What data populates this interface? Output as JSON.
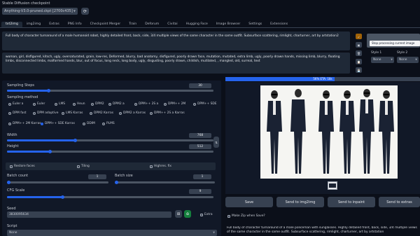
{
  "checkpoint": {
    "label": "Stable Diffusion checkpoint",
    "value": "Anything-V3.0-pruned.ckpt [2700c435]"
  },
  "tabs": [
    "txt2img",
    "img2img",
    "Extras",
    "PNG Info",
    "Checkpoint Merger",
    "Train",
    "Deforum",
    "Civitai",
    "Hugging Face",
    "Image Browser",
    "Settings",
    "Extensions"
  ],
  "active_tab": "txt2img",
  "prompt": "Full body of character turnaround of a male humanoid robot, highly detailed front, back, side, 3/4 multiple views of the same character in the same outfit. Subsurface scattering, rimlight, charturner, art by artstation2",
  "negative_prompt": "woman, girl, disfigured, kitsch, ugly, oversaturated, grain, low-res, Deformed, blurry, bad anatomy, disfigured, poorly drawn face, mutation, mutated, extra limb, ugly, poorly drawn hands, missing limb, blurry, floating limbs, disconnected limbs, malformed hands, blur, out of focus, long neck, long body, ugly, disgusting, poorly drawn, childish, mutilated, , mangled, old, surreal, text",
  "tooltip": "Stop processing current image",
  "styles": [
    {
      "label": "Style 1",
      "value": "None"
    },
    {
      "label": "Style 2",
      "value": "None"
    }
  ],
  "sampling_steps": {
    "label": "Sampling Steps",
    "value": "30",
    "fraction": 0.2
  },
  "sampling_method": {
    "label": "Sampling method",
    "options": [
      "Euler a",
      "Euler",
      "LMS",
      "Heun",
      "DPM2",
      "DPM2 a",
      "DPM++ 2S a",
      "DPM++ 2M",
      "DPM++ SDE",
      "DPM fast",
      "DPM adaptive",
      "LMS Karras",
      "DPM2 Karras",
      "DPM2 a Karras",
      "DPM++ 2S a Karras",
      "DPM++ 2M Karras",
      "DPM++ SDE Karras",
      "DDIM",
      "PLMS"
    ],
    "selected": "DPM++ SDE Karras"
  },
  "width": {
    "label": "Width",
    "value": "768",
    "fraction": 0.33
  },
  "height": {
    "label": "Height",
    "value": "512",
    "fraction": 0.21
  },
  "options": {
    "restore_faces": "Restore faces",
    "tiling": "Tiling",
    "hires_fix": "Highres. fix"
  },
  "batch_count": {
    "label": "Batch count",
    "value": "1",
    "fraction": 0.02
  },
  "batch_size": {
    "label": "Batch size",
    "value": "1",
    "fraction": 0.02
  },
  "cfg_scale": {
    "label": "CFG Scale",
    "value": "9",
    "fraction": 0.27
  },
  "seed": {
    "label": "Seed",
    "value": "3830095634"
  },
  "extra": "Extra",
  "script": {
    "label": "Script",
    "value": "None"
  },
  "progress": {
    "text": "56% ETA: 18s",
    "fraction": 0.56
  },
  "buttons": {
    "save": "Save",
    "send_img2img": "Send to img2img",
    "send_inpaint": "Send to inpaint",
    "send_extras": "Send to extras",
    "zip": "Make Zip when Save?"
  },
  "output_text": "Full body of character turnaround of a male policeman with sunglasses. Highly detailed front, back, side, 3/4 multiple views of the same character in the same outfit. Subsurface scattering, rimlight, charturner, art by artstation",
  "colors": {
    "accent": "#2563eb",
    "background": "#0b0f19",
    "panel": "#1f2937",
    "primary_button": "#ea580c"
  }
}
